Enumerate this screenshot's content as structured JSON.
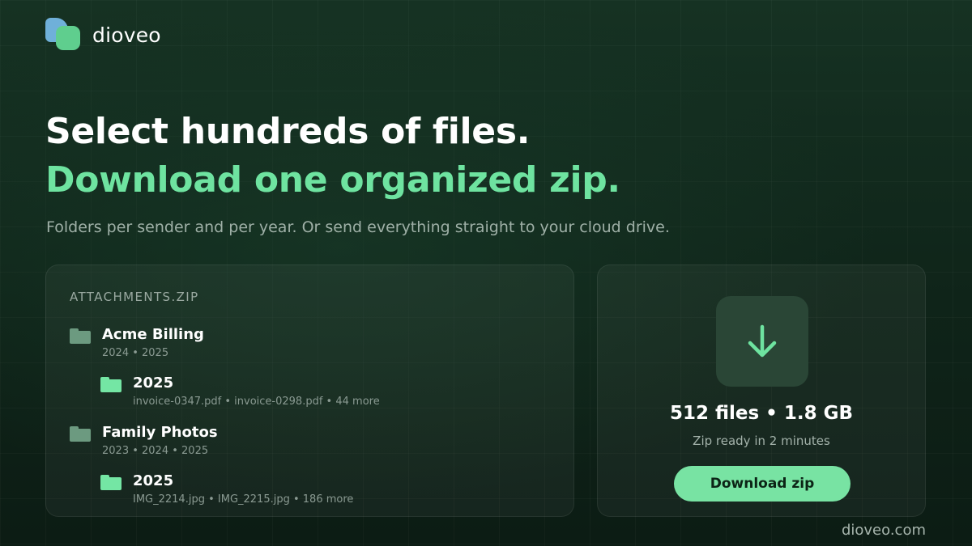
{
  "brand": {
    "name": "dioveo",
    "colors": {
      "logo_blue": "#6fb0d9",
      "logo_green": "#5fce8e",
      "accent": "#6ee3a0"
    }
  },
  "hero": {
    "headline_line1": "Select hundreds of files.",
    "headline_line2": "Download one organized zip.",
    "subline": "Folders per sender and per year. Or send everything straight to your cloud drive."
  },
  "archive": {
    "title": "ATTACHMENTS.ZIP",
    "folders": [
      {
        "name": "Acme Billing",
        "years": "2024 • 2025",
        "subfolder": {
          "name": "2025",
          "files": "invoice-0347.pdf • invoice-0298.pdf • 44 more"
        }
      },
      {
        "name": "Family Photos",
        "years": "2023 • 2024 • 2025",
        "subfolder": {
          "name": "2025",
          "files": "IMG_2214.jpg • IMG_2215.jpg • 186 more"
        }
      }
    ],
    "icons": {
      "sender_folder": "folder-icon",
      "year_folder": "folder-icon"
    }
  },
  "download": {
    "icon": "arrow-down-icon",
    "stats": "512 files • 1.8 GB",
    "eta": "Zip ready in 2 minutes",
    "button_label": "Download zip",
    "button_color": "#78e3a3"
  },
  "footer": {
    "url": "dioveo.com"
  }
}
